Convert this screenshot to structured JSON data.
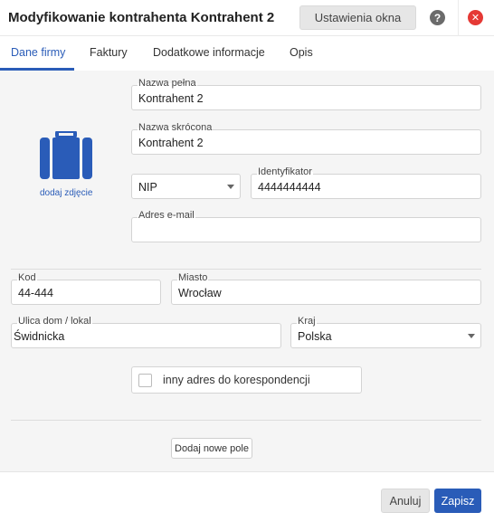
{
  "window": {
    "title": "Modyfikowanie kontrahenta Kontrahent 2",
    "settings_label": "Ustawienia okna",
    "help_glyph": "?",
    "close_glyph": "✕"
  },
  "tabs": [
    {
      "label": "Dane firmy",
      "active": true
    },
    {
      "label": "Faktury",
      "active": false
    },
    {
      "label": "Dodatkowe informacje",
      "active": false
    },
    {
      "label": "Opis",
      "active": false
    }
  ],
  "photo": {
    "icon": "briefcase-icon",
    "link_label": "dodaj zdjęcie"
  },
  "form": {
    "full_name": {
      "label": "Nazwa pełna",
      "value": "Kontrahent 2"
    },
    "short_name": {
      "label": "Nazwa skrócona",
      "value": "Kontrahent 2"
    },
    "id_type": {
      "value": "NIP"
    },
    "identifier": {
      "label": "Identyfikator",
      "value": "4444444444"
    },
    "email": {
      "label": "Adres e-mail",
      "value": ""
    },
    "postal_code": {
      "label": "Kod",
      "value": "44-444"
    },
    "city": {
      "label": "Miasto",
      "value": "Wrocław"
    },
    "street": {
      "label": "Ulica dom / lokal",
      "value": "Świdnicka"
    },
    "country": {
      "label": "Kraj",
      "value": "Polska"
    },
    "alt_address": {
      "label": "inny adres do korespondencji",
      "checked": false
    }
  },
  "add_field_label": "Dodaj nowe pole",
  "footer": {
    "cancel_label": "Anuluj",
    "save_label": "Zapisz"
  },
  "colors": {
    "accent": "#2a5cb8",
    "close": "#e53935",
    "background": "#f5f5f5"
  }
}
